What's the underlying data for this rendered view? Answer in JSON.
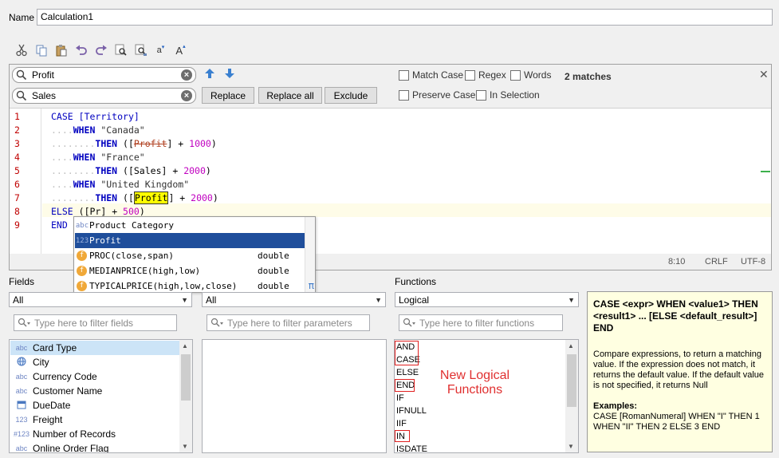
{
  "name_field": {
    "label": "Name",
    "value": "Calculation1"
  },
  "toolbar": {
    "buttons": [
      "cut-icon",
      "copy-icon",
      "paste-icon",
      "undo-icon",
      "redo-icon",
      "find-icon",
      "find-replace-icon",
      "font-decrease-icon",
      "font-increase-icon"
    ],
    "font_small_label": "a",
    "font_large_label": "A"
  },
  "find": {
    "search_value": "Profit",
    "replace_value": "Sales",
    "replace_label": "Replace",
    "replace_all_label": "Replace all",
    "exclude_label": "Exclude",
    "match_case_label": "Match Case",
    "regex_label": "Regex",
    "words_label": "Words",
    "preserve_case_label": "Preserve Case",
    "in_selection_label": "In Selection",
    "matches_label": "2 matches",
    "close_label": "✕"
  },
  "code": {
    "line_numbers": [
      "1",
      "2",
      "3",
      "4",
      "5",
      "6",
      "7",
      "8",
      "9"
    ],
    "l1_kw": "CASE",
    "l1_fld": "[Territory]",
    "l2_kw": "WHEN",
    "l2_str": "\"Canada\"",
    "l3_kw": "THEN",
    "l3_open": "([",
    "l3_fld": "Profit",
    "l3_close": "] + ",
    "l3_num": "1000",
    "l3_end": ")",
    "l4_kw": "WHEN",
    "l4_str": "\"France\"",
    "l5_kw": "THEN",
    "l5_open": "([Sales] + ",
    "l5_num": "2000",
    "l5_end": ")",
    "l6_kw": "WHEN",
    "l6_str": "\"United Kingdom\"",
    "l7_kw": "THEN",
    "l7_open": "([",
    "l7_fld": "Profit",
    "l7_close": "] + ",
    "l7_num": "2000",
    "l7_end": ")",
    "l8_kw": "ELSE",
    "l8_open": "([Pr",
    "l8_close": "] + ",
    "l8_num": "500",
    "l8_end": ")",
    "l9_kw": "END"
  },
  "status": {
    "position": "8:10",
    "line_ending": "CRLF",
    "encoding": "UTF-8"
  },
  "autocomplete": {
    "items": [
      {
        "icon": "abc",
        "label": "Product Category",
        "type": ""
      },
      {
        "icon": "123",
        "label": "Profit",
        "type": ""
      },
      {
        "icon": "f",
        "label": "PROC(close,span)",
        "type": "double"
      },
      {
        "icon": "f",
        "label": "MEDIANPRICE(high,low)",
        "type": "double"
      },
      {
        "icon": "f",
        "label": "TYPICALPRICE(high,low,close)",
        "type": "double"
      }
    ],
    "corner_symbol": "π"
  },
  "fields": {
    "label": "Fields",
    "filter_value": "All",
    "filter_placeholder": "Type here to filter fields",
    "items": [
      {
        "icon": "abc",
        "label": "Card Type"
      },
      {
        "icon": "globe",
        "label": "City"
      },
      {
        "icon": "abc",
        "label": "Currency Code"
      },
      {
        "icon": "abc",
        "label": "Customer Name"
      },
      {
        "icon": "date",
        "label": "DueDate"
      },
      {
        "icon": "123",
        "label": "Freight"
      },
      {
        "icon": "#123",
        "label": "Number of Records"
      },
      {
        "icon": "abc",
        "label": "Online Order Flag"
      }
    ]
  },
  "parameters": {
    "filter_value": "All",
    "filter_placeholder": "Type here to filter parameters"
  },
  "functions": {
    "label": "Functions",
    "filter_value": "Logical",
    "filter_placeholder": "Type here to filter functions",
    "items": [
      "AND",
      "CASE",
      "ELSE",
      "END",
      "IF",
      "IFNULL",
      "IIF",
      "IN",
      "ISDATE"
    ]
  },
  "annotation": {
    "line1": "New Logical",
    "line2": "Functions",
    "color": "#e03030"
  },
  "help": {
    "signature": "CASE <expr> WHEN <value1> THEN <result1> ... [ELSE <default_result>] END",
    "description": "Compare expressions, to return a matching value. If the expression does not match, it returns the default value. If the default value is not specified, it returns Null",
    "examples_label": "Examples:",
    "example": "CASE [RomanNumeral] WHEN \"I\" THEN 1 WHEN \"II\" THEN 2 ELSE 3 END"
  }
}
